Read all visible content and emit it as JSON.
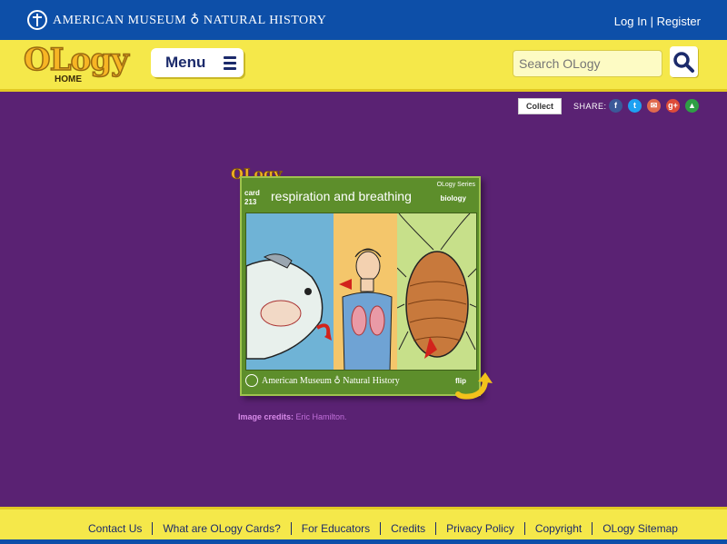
{
  "topbar": {
    "museum_name": "American Museum ♁ Natural History",
    "login": "Log In",
    "separator": "|",
    "register": "Register"
  },
  "header": {
    "logo_word": "OLogy",
    "logo_sub": "HOME",
    "menu_label": "Menu",
    "search_placeholder": "Search OLogy"
  },
  "share": {
    "collect_label": "Collect",
    "share_label": "SHARE:",
    "icons": [
      {
        "name": "facebook-icon",
        "glyph": "f",
        "color": "#3b5998"
      },
      {
        "name": "twitter-icon",
        "glyph": "t",
        "color": "#1da1f2"
      },
      {
        "name": "email-icon",
        "glyph": "✉",
        "color": "#e06a4e"
      },
      {
        "name": "googleplus-icon",
        "glyph": "g+",
        "color": "#dd4b39"
      },
      {
        "name": "classroom-icon",
        "glyph": "▲",
        "color": "#2f9e45"
      }
    ]
  },
  "card": {
    "brand": "OLogy",
    "number_label": "card",
    "number": "213",
    "title": "respiration and breathing",
    "series": "OLogy Series",
    "subject": "biology",
    "footer_text": "American Museum ♁ Natural History",
    "flip_label": "flip"
  },
  "credits": {
    "label": "Image credits:",
    "value": "Eric Hamilton."
  },
  "footer": {
    "links": [
      "Contact Us",
      "What are OLogy Cards?",
      "For Educators",
      "Credits",
      "Privacy Policy",
      "Copyright",
      "OLogy Sitemap"
    ]
  },
  "colors": {
    "brand_blue": "#0d4fa8",
    "header_yellow": "#f5e84a",
    "page_purple": "#5a2273",
    "card_green": "#5d8e2b",
    "navy_text": "#1b2a6b"
  }
}
